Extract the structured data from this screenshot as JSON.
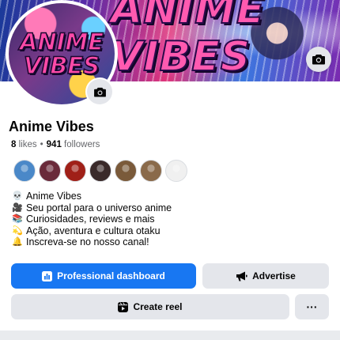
{
  "cover": {
    "title": "ANIME VIBES",
    "camera_icon": "camera-icon"
  },
  "avatar": {
    "line1": "ANIME",
    "line2": "VIBES",
    "camera_icon": "camera-icon"
  },
  "page": {
    "name": "Anime Vibes",
    "likes_count": "8",
    "likes_label": "likes",
    "separator": "•",
    "followers_count": "941",
    "followers_label": "followers"
  },
  "follower_avatars": [
    {
      "color": "#4a88c8"
    },
    {
      "color": "#6a2a3a"
    },
    {
      "color": "#a02018"
    },
    {
      "color": "#3a2a2a"
    },
    {
      "color": "#7a5a3a"
    },
    {
      "color": "#8a6a4a"
    },
    {
      "color": "#f0f0f0"
    }
  ],
  "bio": [
    {
      "icon": "skull",
      "text": "Anime Vibes"
    },
    {
      "icon": "movie-camera",
      "text": "Seu portal para o universo anime"
    },
    {
      "icon": "books",
      "text": "Curiosidades, reviews e mais"
    },
    {
      "icon": "dizzy",
      "text": "Ação, aventura e cultura otaku"
    },
    {
      "icon": "bell",
      "text": "Inscreva-se no nosso canal!"
    }
  ],
  "actions": {
    "professional_dashboard": "Professional dashboard",
    "advertise": "Advertise",
    "create_reel": "Create reel",
    "more": "···"
  },
  "colors": {
    "primary": "#1877f2",
    "secondary_button": "#e4e6eb"
  }
}
